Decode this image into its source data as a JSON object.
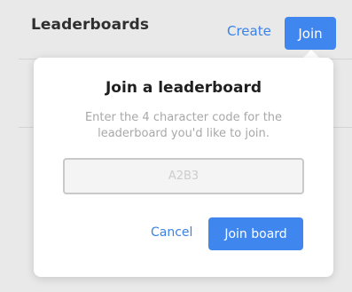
{
  "header": {
    "title": "Leaderboards",
    "create_label": "Create",
    "join_label": "Join"
  },
  "dialog": {
    "title": "Join a leaderboard",
    "description": "Enter the 4 character code for the leaderboard you'd like to join.",
    "code_input": {
      "value": "",
      "placeholder": "A2B3"
    },
    "cancel_label": "Cancel",
    "submit_label": "Join board"
  },
  "colors": {
    "accent": "#3f86ef",
    "link": "#3b82e6",
    "background": "#e9e9e9",
    "dialog_bg": "#ffffff"
  }
}
